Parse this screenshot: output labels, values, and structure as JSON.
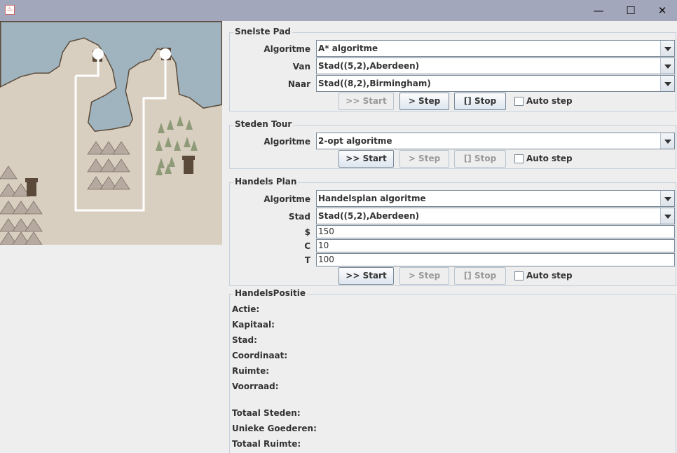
{
  "window": {
    "minimize_glyph": "—",
    "maximize_glyph": "☐",
    "close_glyph": "✕"
  },
  "snelste_pad": {
    "title": "Snelste Pad",
    "algoritme_label": "Algoritme",
    "algoritme_value": "A* algoritme",
    "van_label": "Van",
    "van_value": "Stad((5,2),Aberdeen)",
    "naar_label": "Naar",
    "naar_value": "Stad((8,2),Birmingham)",
    "start_label": ">> Start",
    "step_label": "> Step",
    "stop_label": "[] Stop",
    "auto_step_label": "Auto step"
  },
  "steden_tour": {
    "title": "Steden Tour",
    "algoritme_label": "Algoritme",
    "algoritme_value": "2-opt algoritme",
    "start_label": ">> Start",
    "step_label": "> Step",
    "stop_label": "[] Stop",
    "auto_step_label": "Auto step"
  },
  "handels_plan": {
    "title": "Handels Plan",
    "algoritme_label": "Algoritme",
    "algoritme_value": "Handelsplan algoritme",
    "stad_label": "Stad",
    "stad_value": "Stad((5,2),Aberdeen)",
    "dollar_label": "$",
    "dollar_value": "150",
    "c_label": "C",
    "c_value": "10",
    "t_label": "T",
    "t_value": "100",
    "start_label": ">> Start",
    "step_label": "> Step",
    "stop_label": "[] Stop",
    "auto_step_label": "Auto step"
  },
  "handels_positie": {
    "title": "HandelsPositie",
    "actie": "Actie:",
    "kapitaal": "Kapitaal:",
    "stad": "Stad:",
    "coordinaat": "Coordinaat:",
    "ruimte": "Ruimte:",
    "voorraad": "Voorraad:",
    "totaal_steden": "Totaal Steden:",
    "unieke_goederen": "Unieke Goederen:",
    "totaal_ruimte": "Totaal Ruimte:"
  },
  "colors": {
    "titlebar": "#a3a7bb",
    "water": "#9fb4bf",
    "land": "#d9cfc0",
    "path": "#ffffff"
  }
}
